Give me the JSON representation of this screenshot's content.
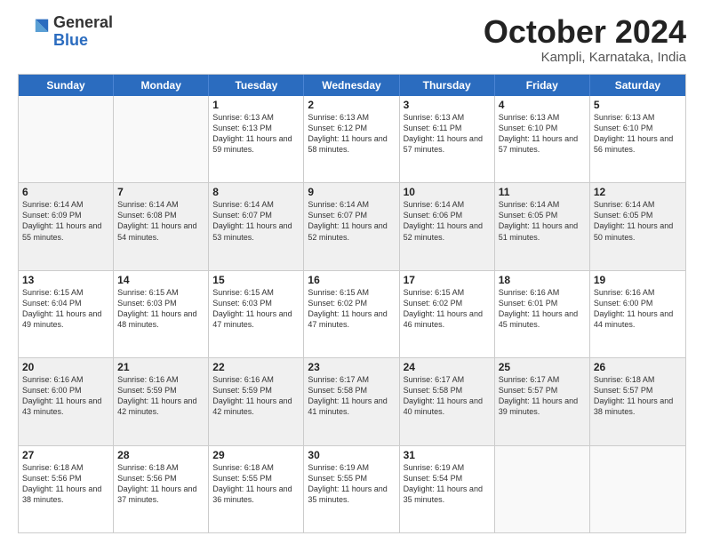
{
  "logo": {
    "general": "General",
    "blue": "Blue"
  },
  "title": "October 2024",
  "subtitle": "Kampli, Karnataka, India",
  "header_days": [
    "Sunday",
    "Monday",
    "Tuesday",
    "Wednesday",
    "Thursday",
    "Friday",
    "Saturday"
  ],
  "rows": [
    [
      {
        "day": "",
        "info": "",
        "empty": true
      },
      {
        "day": "",
        "info": "",
        "empty": true
      },
      {
        "day": "1",
        "info": "Sunrise: 6:13 AM\nSunset: 6:13 PM\nDaylight: 11 hours and 59 minutes."
      },
      {
        "day": "2",
        "info": "Sunrise: 6:13 AM\nSunset: 6:12 PM\nDaylight: 11 hours and 58 minutes."
      },
      {
        "day": "3",
        "info": "Sunrise: 6:13 AM\nSunset: 6:11 PM\nDaylight: 11 hours and 57 minutes."
      },
      {
        "day": "4",
        "info": "Sunrise: 6:13 AM\nSunset: 6:10 PM\nDaylight: 11 hours and 57 minutes."
      },
      {
        "day": "5",
        "info": "Sunrise: 6:13 AM\nSunset: 6:10 PM\nDaylight: 11 hours and 56 minutes."
      }
    ],
    [
      {
        "day": "6",
        "info": "Sunrise: 6:14 AM\nSunset: 6:09 PM\nDaylight: 11 hours and 55 minutes."
      },
      {
        "day": "7",
        "info": "Sunrise: 6:14 AM\nSunset: 6:08 PM\nDaylight: 11 hours and 54 minutes."
      },
      {
        "day": "8",
        "info": "Sunrise: 6:14 AM\nSunset: 6:07 PM\nDaylight: 11 hours and 53 minutes."
      },
      {
        "day": "9",
        "info": "Sunrise: 6:14 AM\nSunset: 6:07 PM\nDaylight: 11 hours and 52 minutes."
      },
      {
        "day": "10",
        "info": "Sunrise: 6:14 AM\nSunset: 6:06 PM\nDaylight: 11 hours and 52 minutes."
      },
      {
        "day": "11",
        "info": "Sunrise: 6:14 AM\nSunset: 6:05 PM\nDaylight: 11 hours and 51 minutes."
      },
      {
        "day": "12",
        "info": "Sunrise: 6:14 AM\nSunset: 6:05 PM\nDaylight: 11 hours and 50 minutes."
      }
    ],
    [
      {
        "day": "13",
        "info": "Sunrise: 6:15 AM\nSunset: 6:04 PM\nDaylight: 11 hours and 49 minutes."
      },
      {
        "day": "14",
        "info": "Sunrise: 6:15 AM\nSunset: 6:03 PM\nDaylight: 11 hours and 48 minutes."
      },
      {
        "day": "15",
        "info": "Sunrise: 6:15 AM\nSunset: 6:03 PM\nDaylight: 11 hours and 47 minutes."
      },
      {
        "day": "16",
        "info": "Sunrise: 6:15 AM\nSunset: 6:02 PM\nDaylight: 11 hours and 47 minutes."
      },
      {
        "day": "17",
        "info": "Sunrise: 6:15 AM\nSunset: 6:02 PM\nDaylight: 11 hours and 46 minutes."
      },
      {
        "day": "18",
        "info": "Sunrise: 6:16 AM\nSunset: 6:01 PM\nDaylight: 11 hours and 45 minutes."
      },
      {
        "day": "19",
        "info": "Sunrise: 6:16 AM\nSunset: 6:00 PM\nDaylight: 11 hours and 44 minutes."
      }
    ],
    [
      {
        "day": "20",
        "info": "Sunrise: 6:16 AM\nSunset: 6:00 PM\nDaylight: 11 hours and 43 minutes."
      },
      {
        "day": "21",
        "info": "Sunrise: 6:16 AM\nSunset: 5:59 PM\nDaylight: 11 hours and 42 minutes."
      },
      {
        "day": "22",
        "info": "Sunrise: 6:16 AM\nSunset: 5:59 PM\nDaylight: 11 hours and 42 minutes."
      },
      {
        "day": "23",
        "info": "Sunrise: 6:17 AM\nSunset: 5:58 PM\nDaylight: 11 hours and 41 minutes."
      },
      {
        "day": "24",
        "info": "Sunrise: 6:17 AM\nSunset: 5:58 PM\nDaylight: 11 hours and 40 minutes."
      },
      {
        "day": "25",
        "info": "Sunrise: 6:17 AM\nSunset: 5:57 PM\nDaylight: 11 hours and 39 minutes."
      },
      {
        "day": "26",
        "info": "Sunrise: 6:18 AM\nSunset: 5:57 PM\nDaylight: 11 hours and 38 minutes."
      }
    ],
    [
      {
        "day": "27",
        "info": "Sunrise: 6:18 AM\nSunset: 5:56 PM\nDaylight: 11 hours and 38 minutes."
      },
      {
        "day": "28",
        "info": "Sunrise: 6:18 AM\nSunset: 5:56 PM\nDaylight: 11 hours and 37 minutes."
      },
      {
        "day": "29",
        "info": "Sunrise: 6:18 AM\nSunset: 5:55 PM\nDaylight: 11 hours and 36 minutes."
      },
      {
        "day": "30",
        "info": "Sunrise: 6:19 AM\nSunset: 5:55 PM\nDaylight: 11 hours and 35 minutes."
      },
      {
        "day": "31",
        "info": "Sunrise: 6:19 AM\nSunset: 5:54 PM\nDaylight: 11 hours and 35 minutes."
      },
      {
        "day": "",
        "info": "",
        "empty": true
      },
      {
        "day": "",
        "info": "",
        "empty": true
      }
    ]
  ]
}
